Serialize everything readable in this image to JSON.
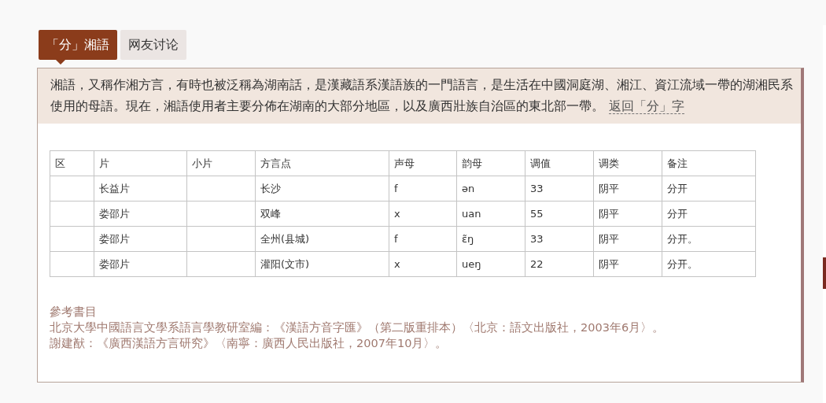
{
  "tabs": [
    {
      "label": "「分」湘語",
      "selected": true
    },
    {
      "label": "网友讨论",
      "selected": false
    }
  ],
  "intro": {
    "text": "湘語，又稱作湘方言，有時也被泛稱為湖南話，是漢藏語系漢語族的一門語言，是生活在中國洞庭湖、湘江、資江流域一帶的湖湘民系使用的母語。現在，湘語使用者主要分佈在湖南的大部分地區，以及廣西壯族自治區的東北部一帶。",
    "link": "返回「分」字"
  },
  "table": {
    "columns": [
      "区",
      "片",
      "小片",
      "方言点",
      "声母",
      "韵母",
      "调值",
      "调类",
      "备注"
    ],
    "rows": [
      [
        "",
        "长益片",
        "",
        "长沙",
        "f",
        "ən",
        "33",
        "阴平",
        "分开"
      ],
      [
        "",
        "娄邵片",
        "",
        "双峰",
        "x",
        "uan",
        "55",
        "阴平",
        "分开"
      ],
      [
        "",
        "娄邵片",
        "",
        "全州(县城)",
        "f",
        "ɛ̃ŋ",
        "33",
        "阴平",
        "分开。"
      ],
      [
        "",
        "娄邵片",
        "",
        "灌阳(文市)",
        "x",
        "ueŋ",
        "22",
        "阴平",
        "分开。"
      ]
    ]
  },
  "references": {
    "title": "參考書目",
    "items": [
      "北京大學中國語言文學系語言學教研室編：《漢語方音字匯》（第二版重排本）〈北京：語文出版社，2003年6月〉。",
      "謝建猷：《廣西漢語方言研究》〈南寧：廣西人民出版社，2007年10月〉。"
    ]
  }
}
